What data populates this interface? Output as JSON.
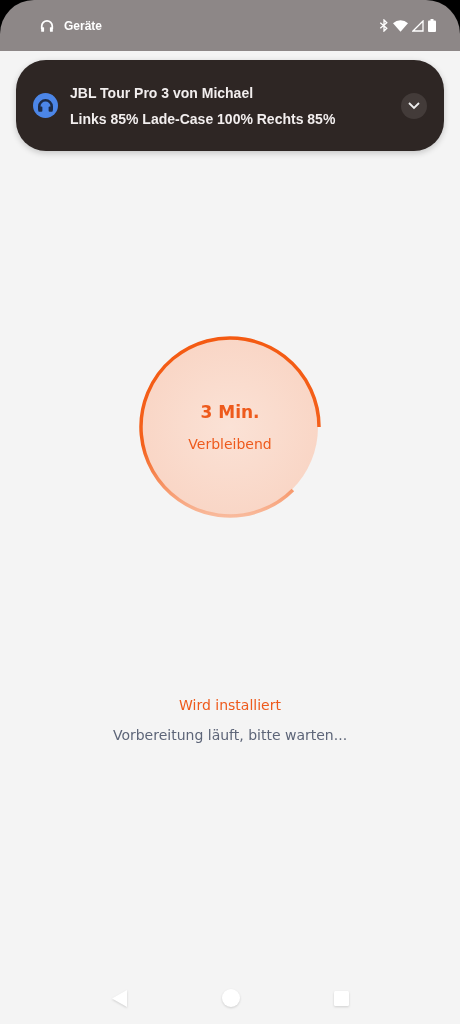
{
  "status_bar": {
    "label": "Geräte"
  },
  "notification": {
    "title": "JBL Tour Pro 3 von Michael",
    "text": "Links 85% Lade-Case 100% Rechts 85%",
    "expanded": false
  },
  "progress": {
    "time": "3 Min.",
    "caption": "Verbleibend"
  },
  "install": {
    "title": "Wird installiert",
    "message": "Vorbereitung läuft, bitte warten..."
  }
}
